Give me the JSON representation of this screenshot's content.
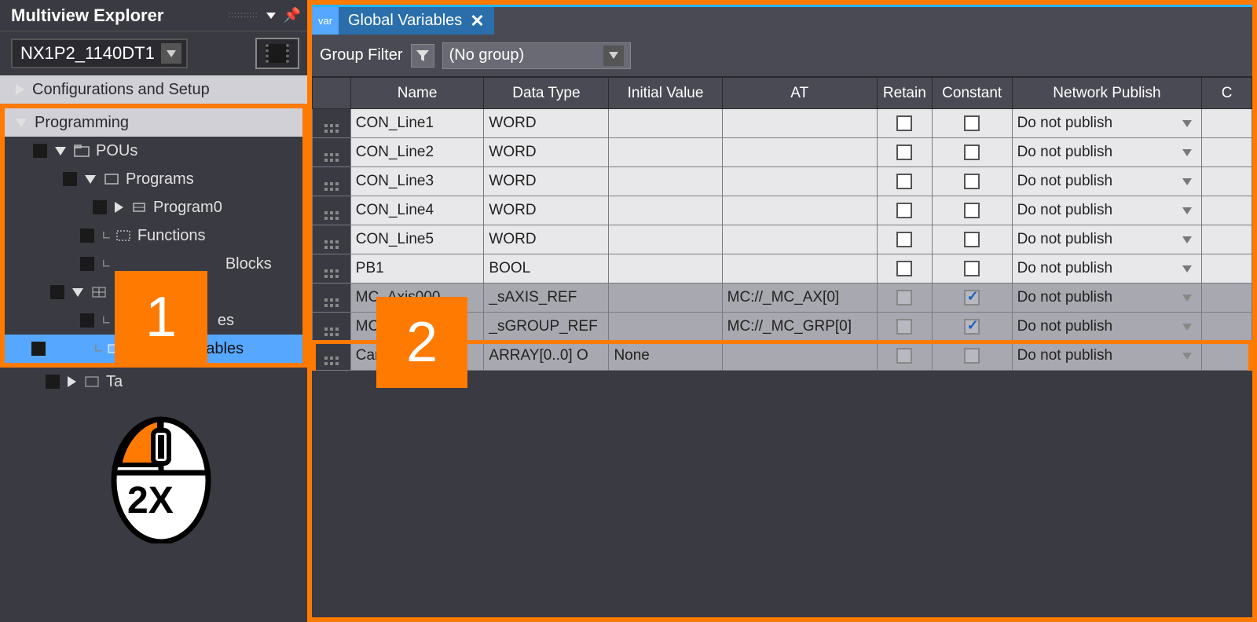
{
  "explorer": {
    "title": "Multiview Explorer",
    "device": "NX1P2_1140DT1",
    "tree": {
      "config": "Configurations and Setup",
      "programming": "Programming",
      "pous": "POUs",
      "programs": "Programs",
      "program0": "Program0",
      "functions": "Functions",
      "blocks": "Blocks",
      "dataNode": "",
      "dataNodeSuffix": "es",
      "globalVars": "Global Variables",
      "tasks": "Ta"
    },
    "mouse_label": "2X"
  },
  "annotations": {
    "marker1": "1",
    "marker2": "2"
  },
  "editor": {
    "tab_label": "Global Variables",
    "tab_prefix": "var",
    "filter_label": "Group Filter",
    "group_value": "(No group)",
    "headers": {
      "name": "Name",
      "dtype": "Data Type",
      "init": "Initial Value",
      "at": "AT",
      "retain": "Retain",
      "const": "Constant",
      "netpub": "Network Publish",
      "c": "C"
    },
    "rows": [
      {
        "name": "CON_Line1",
        "dtype": "WORD",
        "init": "",
        "at": "",
        "retain": false,
        "const": false,
        "np": "Do not publish",
        "style": "normal"
      },
      {
        "name": "CON_Line2",
        "dtype": "WORD",
        "init": "",
        "at": "",
        "retain": false,
        "const": false,
        "np": "Do not publish",
        "style": "normal"
      },
      {
        "name": "CON_Line3",
        "dtype": "WORD",
        "init": "",
        "at": "",
        "retain": false,
        "const": false,
        "np": "Do not publish",
        "style": "normal"
      },
      {
        "name": "CON_Line4",
        "dtype": "WORD",
        "init": "",
        "at": "",
        "retain": false,
        "const": false,
        "np": "Do not publish",
        "style": "normal"
      },
      {
        "name": "CON_Line5",
        "dtype": "WORD",
        "init": "",
        "at": "",
        "retain": false,
        "const": false,
        "np": "Do not publish",
        "style": "normal"
      },
      {
        "name": "PB1",
        "dtype": "BOOL",
        "init": "",
        "at": "",
        "retain": false,
        "const": false,
        "np": "Do not publish",
        "style": "normal"
      },
      {
        "name": "MC_Axis000",
        "dtype": "_sAXIS_REF",
        "init": "",
        "at": "MC://_MC_AX[0]",
        "retain": "disabled",
        "const": "checked-disabled",
        "np": "Do not publish",
        "style": "greyed"
      },
      {
        "name": "MC_Group000",
        "dtype": "_sGROUP_REF",
        "init": "",
        "at": "MC://_MC_GRP[0]",
        "retain": "disabled",
        "const": "checked-disabled",
        "np": "Do not publish",
        "style": "greyed"
      },
      {
        "name": "CamProfile0",
        "dtype": "ARRAY[0..0] O",
        "init": "None",
        "at": "",
        "retain": "disabled",
        "const": "disabled",
        "np": "Do not publish",
        "style": "greyed2"
      }
    ]
  }
}
